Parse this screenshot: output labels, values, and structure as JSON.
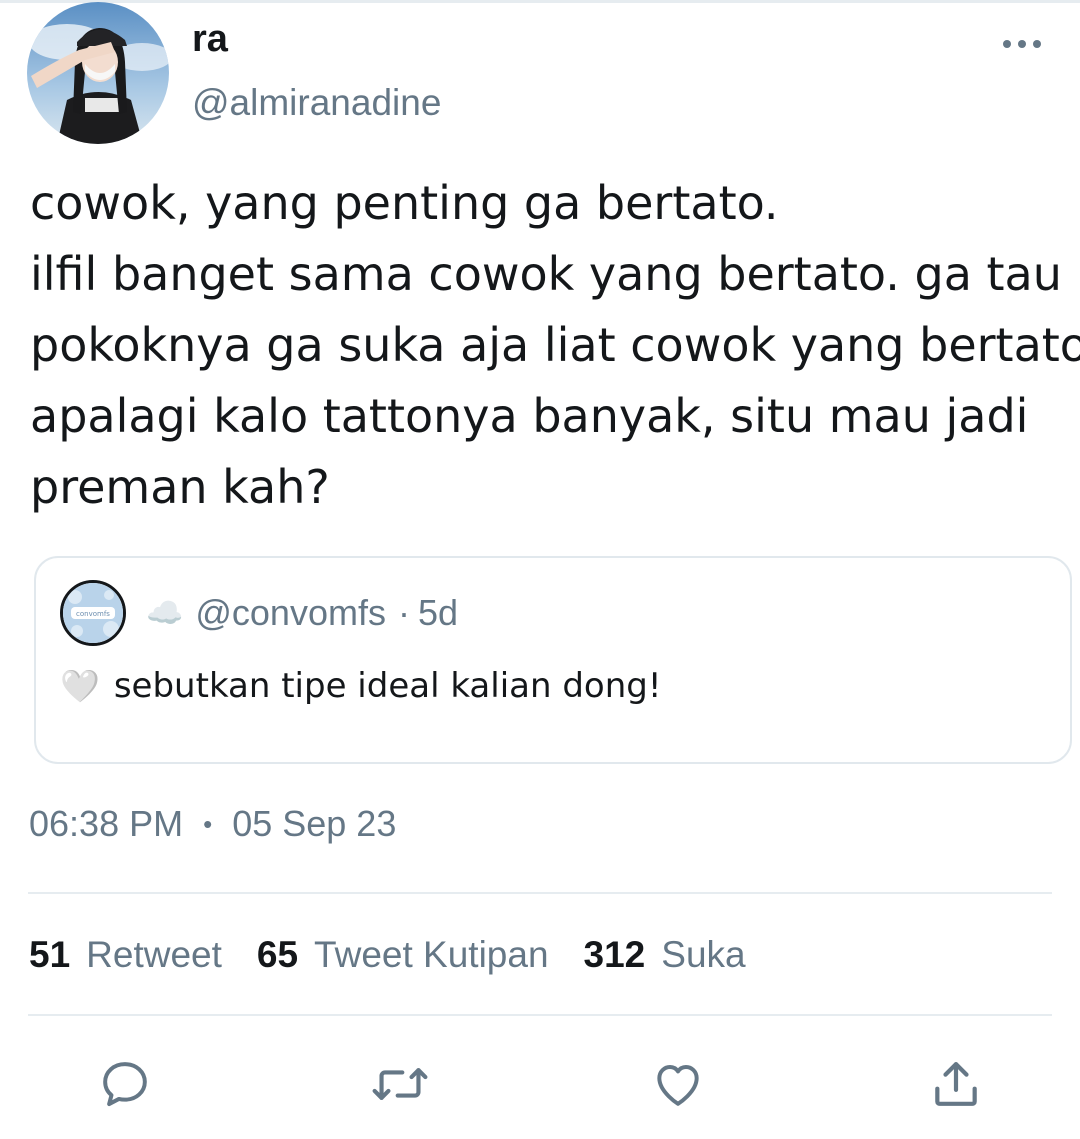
{
  "author": {
    "display_name": "ra",
    "handle": "@almiranadine"
  },
  "tweet": {
    "lines": [
      "cowok, yang penting ga bertato.",
      "ilfil banget sama cowok yang bertato. ga tau",
      "pokoknya ga suka aja liat cowok yang bertato",
      "apalagi kalo tattonya banyak, situ mau jadi",
      "preman kah?"
    ]
  },
  "quoted_tweet": {
    "avatar_text": "convomfs",
    "name_emoji": "☁️",
    "handle": "@convomfs",
    "separator": "·",
    "age": "5d",
    "emoji": "🤍",
    "text": "sebutkan tipe ideal kalian dong!"
  },
  "timestamp": {
    "time": "06:38 PM",
    "separator": "•",
    "date": "05 Sep 23"
  },
  "stats": {
    "retweets": {
      "count": "51",
      "label": "Retweet"
    },
    "quotes": {
      "count": "65",
      "label": "Tweet Kutipan"
    },
    "likes": {
      "count": "312",
      "label": "Suka"
    }
  },
  "icons": {
    "more": "more-horizontal-icon",
    "reply": "reply-icon",
    "retweet": "retweet-icon",
    "like": "heart-icon",
    "share": "share-icon"
  },
  "colors": {
    "text": "#14171a",
    "secondary": "#657786",
    "border": "#e1e8ed",
    "divider": "#e6ecf0"
  }
}
